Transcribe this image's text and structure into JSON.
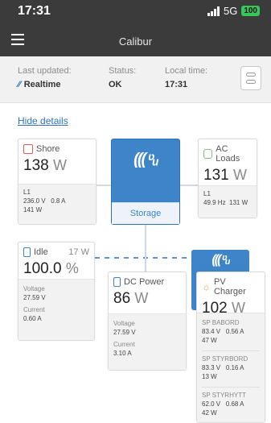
{
  "status_bar": {
    "time": "17:31",
    "network": "5G",
    "battery": "100"
  },
  "header": {
    "title": "Calibur"
  },
  "info": {
    "last_updated_label": "Last updated:",
    "last_updated_value": "Realtime",
    "status_label": "Status:",
    "status_value": "OK",
    "local_time_label": "Local time:",
    "local_time_value": "17:31"
  },
  "hide_details": "Hide details",
  "shore": {
    "label": "Shore",
    "power": "138",
    "unit": "W",
    "line": "L1",
    "voltage": "236.0 V",
    "current": "0.8 A",
    "watts": "141 W"
  },
  "storage": {
    "label": "Storage"
  },
  "ac_loads": {
    "label": "AC Loads",
    "power": "131",
    "unit": "W",
    "line": "L1",
    "freq": "49.9 Hz",
    "watts": "131 W"
  },
  "battery": {
    "label": "Idle",
    "watts": "17 W",
    "soc": "100.0",
    "unit": "%",
    "voltage_label": "Voltage",
    "voltage": "27.59 V",
    "current_label": "Current",
    "current": "0.60 A"
  },
  "dc_power": {
    "label": "DC Power",
    "power": "86",
    "unit": "W",
    "voltage_label": "Voltage",
    "voltage": "27.59 V",
    "current_label": "Current",
    "current": "3.10 A"
  },
  "pv_charger": {
    "label": "PV Charger",
    "power": "102",
    "unit": "W",
    "trackers": [
      {
        "name": "SP BABORD",
        "voltage": "83.4 V",
        "current": "0.56 A",
        "watts": "47 W"
      },
      {
        "name": "SP STYRBORD",
        "voltage": "83.3 V",
        "current": "0.16 A",
        "watts": "13 W"
      },
      {
        "name": "SP STYRHYTT",
        "voltage": "62.0 V",
        "current": "0.68 A",
        "watts": "42 W"
      }
    ]
  },
  "colors": {
    "header_bg": "#3b3b3b",
    "accent_blue": "#3d84c8",
    "shore_red": "#e05a5a",
    "ac_green": "#7cc67c",
    "dc_blue": "#3d84c8",
    "pv_orange": "#f0a030"
  }
}
